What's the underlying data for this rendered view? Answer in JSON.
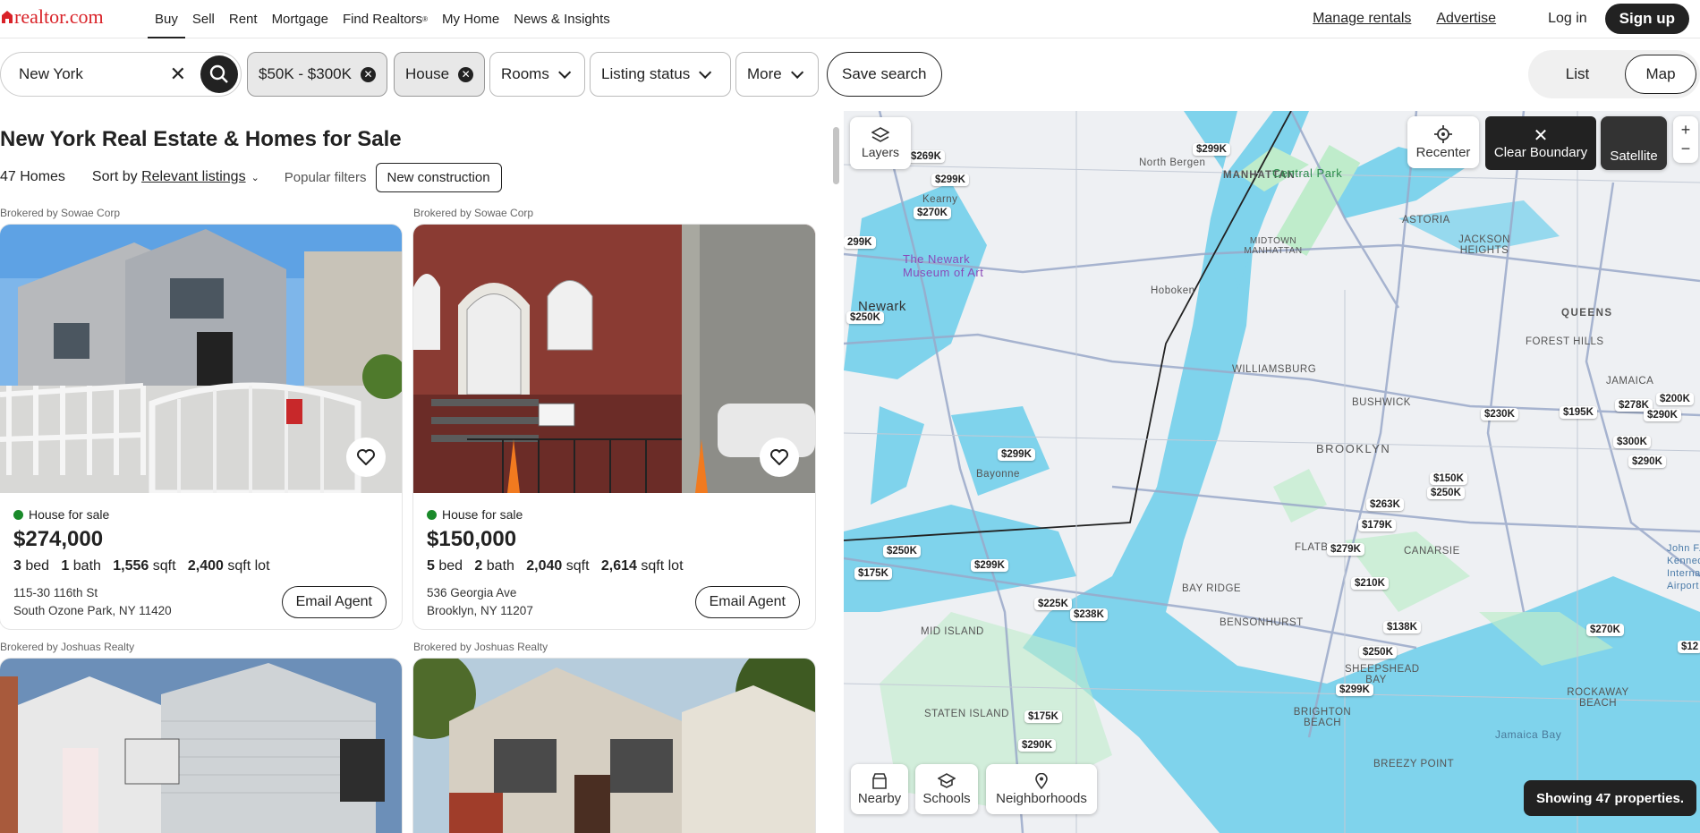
{
  "brand": "realtor.com",
  "nav": {
    "items": [
      "Buy",
      "Sell",
      "Rent",
      "Mortgage",
      "Find Realtors",
      "My Home",
      "News & Insights"
    ],
    "find_realtors_mark": "®"
  },
  "topright": {
    "manage_rentals": "Manage rentals",
    "advertise": "Advertise",
    "login": "Log in",
    "signup": "Sign up"
  },
  "search": {
    "value": "New York"
  },
  "filters": {
    "price": "$50K - $300K",
    "type": "House",
    "rooms": "Rooms",
    "listing_status": "Listing status",
    "more": "More",
    "save_search": "Save search"
  },
  "view_toggle": {
    "list": "List",
    "map": "Map",
    "active": "Map"
  },
  "results": {
    "title": "New York Real Estate & Homes for Sale",
    "count": "47 Homes",
    "sort_prefix": "Sort by",
    "sort_value": "Relevant listings",
    "popular_filters": "Popular filters",
    "new_construction": "New construction"
  },
  "listings": [
    {
      "broker": "Brokered by Sowae Corp",
      "status": "House for sale",
      "price": "$274,000",
      "bed": "3",
      "bath": "1",
      "sqft": "1,556",
      "lot": "2,400",
      "addr1": "115-30 116th St",
      "addr2": "South Ozone Park, NY 11420",
      "email": "Email Agent"
    },
    {
      "broker": "Brokered by Sowae Corp",
      "status": "House for sale",
      "price": "$150,000",
      "bed": "5",
      "bath": "2",
      "sqft": "2,040",
      "lot": "2,614",
      "addr1": "536 Georgia Ave",
      "addr2": "Brooklyn, NY 11207",
      "email": "Email Agent"
    },
    {
      "broker": "Brokered by Joshuas Realty"
    },
    {
      "broker": "Brokered by Joshuas Realty"
    }
  ],
  "spec_labels": {
    "bed": "bed",
    "bath": "bath",
    "sqft": "sqft",
    "lot": "sqft lot"
  },
  "map": {
    "layers": "Layers",
    "recenter": "Recenter",
    "clear_boundary": "Clear Boundary",
    "satellite": "Satellite",
    "nearby": "Nearby",
    "schools": "Schools",
    "neighborhoods": "Neighborhoods",
    "showing": "Showing 47 properties.",
    "zoom_in": "+",
    "zoom_out": "−",
    "places": [
      "North Bergen",
      "Kearny",
      "MANHATTAN",
      "MIDTOWN MANHATTAN",
      "ASTORIA",
      "JACKSON HEIGHTS",
      "Central Park",
      "The Newark Museum of Art",
      "Hoboken",
      "Newark",
      "QUEENS",
      "FOREST HILLS",
      "WILLIAMSBURG",
      "BUSHWICK",
      "JAMAICA",
      "BROOKLYN",
      "Bayonne",
      "CANARSIE",
      "FLATB",
      "BAY RIDGE",
      "BENSONHURST",
      "SHEEPSHEAD BAY",
      "BRIGHTON BEACH",
      "MID ISLAND",
      "STATEN ISLAND",
      "BREEZY POINT",
      "ROCKAWAY BEACH",
      "Jamaica Bay",
      "John F. Kennedy International Airport"
    ],
    "pins": [
      "$299K",
      "$269K",
      "$299K",
      "$270K",
      "299K",
      "$250K",
      "$299K",
      "$250K",
      "$175K",
      "$299K",
      "$225K",
      "$238K",
      "$175K",
      "$290K",
      "$230K",
      "$195K",
      "$278K",
      "$200K",
      "$290K",
      "$300K",
      "$290K",
      "$150K",
      "$250K",
      "$263K",
      "$179K",
      "$279K",
      "$210K",
      "$138K",
      "$250K",
      "$299K",
      "$270K",
      "$12"
    ]
  }
}
